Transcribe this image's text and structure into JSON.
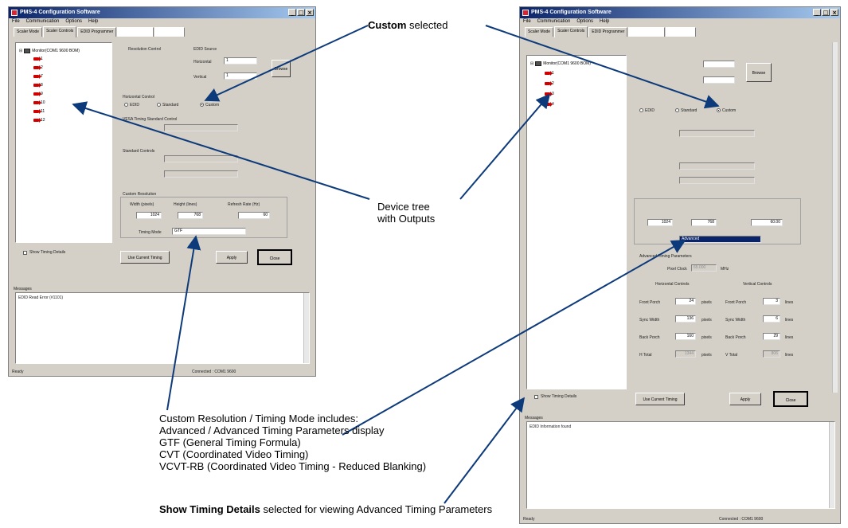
{
  "left_window": {
    "title": "PMS-4 Configuration Software",
    "menu": [
      "File",
      "Communication",
      "Options",
      "Help"
    ],
    "tabs": [
      "Scaler Mode",
      "Scaler Controls",
      "EDID Programmer"
    ],
    "tree": {
      "root": "Monitor(COM1 9600 BOM)",
      "outputs": [
        "1",
        "2",
        "7",
        "8",
        "9",
        "10",
        "11",
        "12"
      ]
    },
    "groups": {
      "resolution_control": "Resolution Control",
      "edid_source": "EDID Source",
      "horizontal_control": "Horizontal Control",
      "vesa_timing": "VESA Timing Standard Control",
      "standard_controls": "Standard Controls",
      "custom_resolution": "Custom Resolution"
    },
    "radios": [
      "EDID",
      "Standard",
      "Custom"
    ],
    "fields": {
      "horizontal_label": "Horizontal",
      "horizontal_value": "1",
      "vertical_label": "Vertical",
      "vertical_value": "1",
      "width_label": "Width (pixels)",
      "width_value": "1024",
      "height_label": "Height (lines)",
      "height_value": "768",
      "refresh_label": "Refresh Rate (Hz)",
      "refresh_value": "60",
      "timing_mode_label": "Timing Mode",
      "timing_mode_value": "GTF"
    },
    "buttons": {
      "use_current": "Use Current Timing",
      "apply": "Apply",
      "close": "Close",
      "browse": "Browse"
    },
    "show_timing": "Show Timing Details",
    "messages_label": "Messages",
    "messages_text": "EDID Read Error (#1101)",
    "status_left": "Ready",
    "status_right": "Connected : COM1 9600"
  },
  "right_window": {
    "title": "PMS-4 Configuration Software",
    "menu": [
      "File",
      "Communication",
      "Options",
      "Help"
    ],
    "tabs": [
      "Scaler Mode",
      "Scaler Controls",
      "EDID Programmer"
    ],
    "tree": {
      "root": "Monitor(COM1 9600 BOM)",
      "outputs": [
        "1",
        "2",
        "3",
        "4"
      ]
    },
    "radios": [
      "EDID",
      "Standard",
      "Custom"
    ],
    "custom": {
      "width_value": "1024",
      "height_value": "768",
      "refresh_value": "60.00",
      "timing_mode_value": "Advanced"
    },
    "advanced": {
      "title": "Advanced Timing Parameters",
      "pixel_clock_label": "Pixel Clock",
      "pixel_clock_value": "65.000",
      "pixel_clock_unit": "MHz",
      "horizontal_title": "Horizontal Controls",
      "vertical_title": "Vertical Controls",
      "rows": [
        {
          "h_label": "Front Porch",
          "h_value": "24",
          "h_unit": "pixels",
          "v_label": "Front Porch",
          "v_value": "3",
          "v_unit": "lines"
        },
        {
          "h_label": "Sync Width",
          "h_value": "136",
          "h_unit": "pixels",
          "v_label": "Sync Width",
          "v_value": "6",
          "v_unit": "lines"
        },
        {
          "h_label": "Back Porch",
          "h_value": "160",
          "h_unit": "pixels",
          "v_label": "Back Porch",
          "v_value": "29",
          "v_unit": "lines"
        },
        {
          "h_label": "H Total",
          "h_value": "1344",
          "h_unit": "pixels",
          "v_label": "V Total",
          "v_value": "806",
          "v_unit": "lines"
        }
      ]
    },
    "buttons": {
      "use_current": "Use Current Timing",
      "apply": "Apply",
      "close": "Close",
      "browse": "Browse"
    },
    "show_timing": "Show Timing Details",
    "messages_label": "Messages",
    "messages_text": "EDID Information found",
    "status_left": "Ready",
    "status_right": "Connected : COM1 9600"
  },
  "callouts": {
    "custom_selected_bold": "Custom",
    "custom_selected_rest": " selected",
    "device_tree_line1": "Device tree",
    "device_tree_line2": "with Outputs",
    "timing_mode_lines": [
      "Custom Resolution / Timing Mode includes:",
      "Advanced / Advanced Timing Parameters display",
      "GTF (General Timing Formula)",
      "CVT (Coordinated Video Timing)",
      "VCVT-RB (Coordinated Video Timing - Reduced Blanking)"
    ],
    "show_timing_bold": "Show Timing Details",
    "show_timing_rest": " selected for viewing Advanced Timing Parameters"
  },
  "colors": {
    "arrow": "#0d3a7a",
    "titlebar": "#0a246a",
    "output_icon": "#d00000",
    "selection": "#0a246a"
  }
}
